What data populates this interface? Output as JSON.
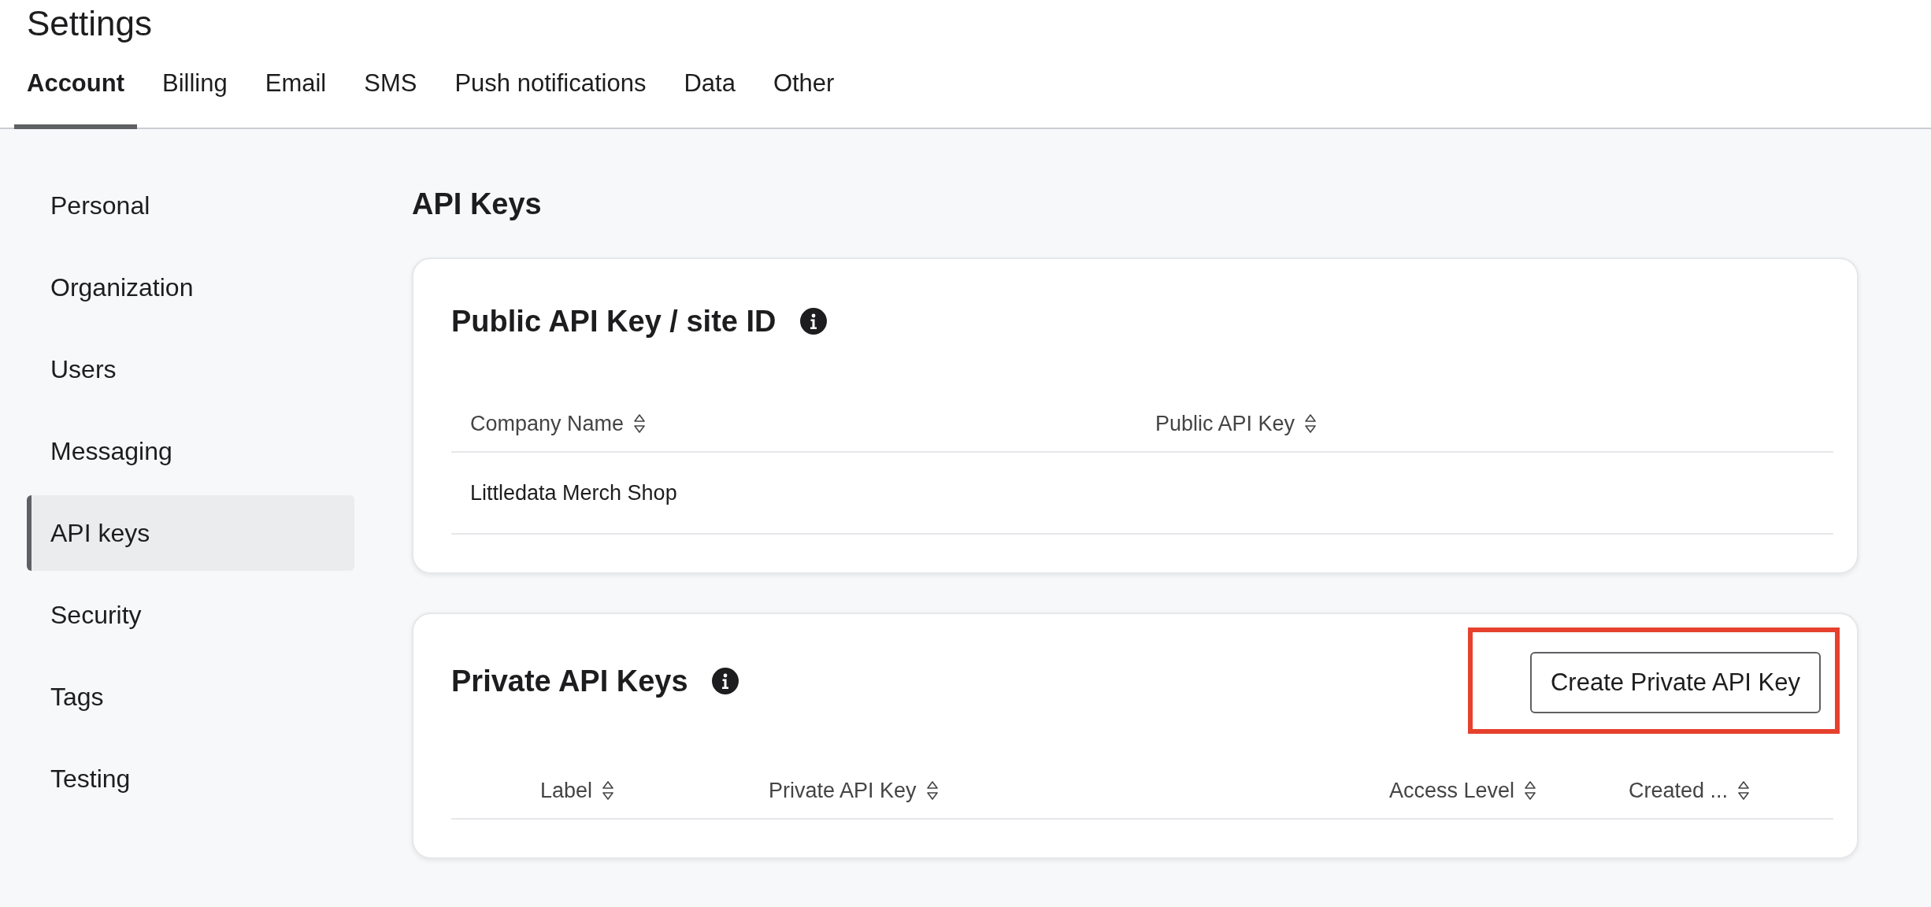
{
  "page": {
    "title": "Settings"
  },
  "tabs": [
    {
      "label": "Account",
      "selected": true
    },
    {
      "label": "Billing",
      "selected": false
    },
    {
      "label": "Email",
      "selected": false
    },
    {
      "label": "SMS",
      "selected": false
    },
    {
      "label": "Push notifications",
      "selected": false
    },
    {
      "label": "Data",
      "selected": false
    },
    {
      "label": "Other",
      "selected": false
    }
  ],
  "sidebar": {
    "items": [
      {
        "label": "Personal",
        "selected": false
      },
      {
        "label": "Organization",
        "selected": false
      },
      {
        "label": "Users",
        "selected": false
      },
      {
        "label": "Messaging",
        "selected": false
      },
      {
        "label": "API keys",
        "selected": true
      },
      {
        "label": "Security",
        "selected": false
      },
      {
        "label": "Tags",
        "selected": false
      },
      {
        "label": "Testing",
        "selected": false
      }
    ]
  },
  "main": {
    "title": "API Keys",
    "public_card": {
      "title": "Public API Key / site ID",
      "table": {
        "columns": [
          "Company Name",
          "Public API Key"
        ],
        "rows": [
          {
            "cells": [
              "Littledata Merch Shop"
            ]
          }
        ]
      }
    },
    "private_card": {
      "title": "Private API Keys",
      "button": {
        "label": "Create Private API Key",
        "highlighted": true
      },
      "table": {
        "columns": [
          "Label",
          "Private API Key",
          "Access Level",
          "Created ..."
        ]
      }
    }
  }
}
